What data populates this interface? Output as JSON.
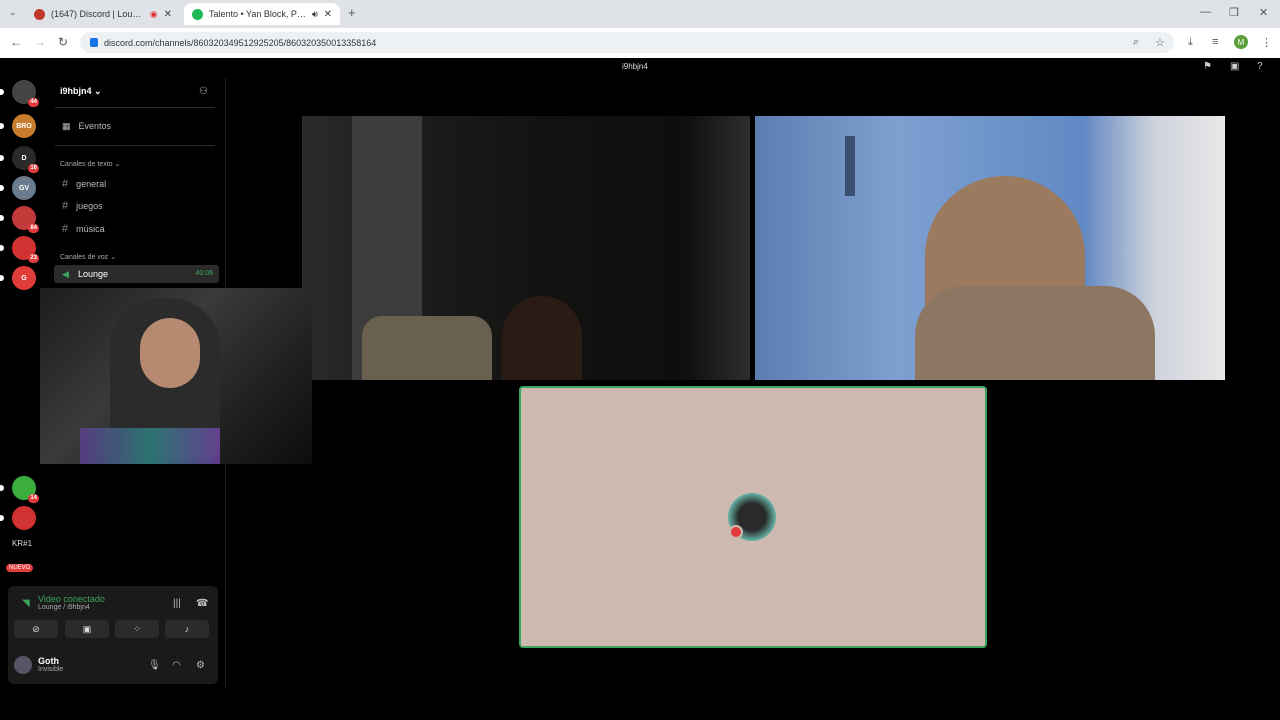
{
  "browser": {
    "tabs": [
      {
        "title": "(1647) Discord | Lounge | i9",
        "active": false,
        "favicon_color": "#5865f2"
      },
      {
        "title": "Talento • Yan Block, Panda (",
        "active": true,
        "favicon_color": "#1db954"
      }
    ],
    "url": "discord.com/channels/860320349512925205/860320350013358164",
    "profile_initial": "M"
  },
  "discord": {
    "header_title": "i9hbjn4",
    "guild_name": "i9hbjn4",
    "events_label": "Eventos",
    "text_category": "Canales de texto",
    "text_channels": [
      "general",
      "juegos",
      "música"
    ],
    "voice_category": "Canales de voz",
    "voice_channel": {
      "name": "Lounge",
      "time": "40:06"
    },
    "servers": [
      {
        "label": "",
        "badge": "44",
        "color": "#444"
      },
      {
        "label": "BRO",
        "badge": "",
        "color": "#c77d2b"
      },
      {
        "label": "D",
        "badge": "16",
        "color": "#2a2a2a"
      },
      {
        "label": "GV",
        "badge": "",
        "color": "#6b7c8c"
      },
      {
        "label": "",
        "badge": "84",
        "color": "#c23a3a"
      },
      {
        "label": "",
        "badge": "23",
        "color": "#d23232"
      },
      {
        "label": "G",
        "badge": "",
        "color": "#e03c3c"
      },
      {
        "label": "",
        "badge": "14",
        "color": "#3cae3c"
      },
      {
        "label": "",
        "badge": "",
        "color": "#d23232"
      }
    ],
    "kr_label": "KR#1",
    "new_label": "NUEVO",
    "voice_status": {
      "title": "Video conectado",
      "sub": "Lounge / i9hbjn4"
    },
    "user": {
      "name": "Goth",
      "status": "Invisible"
    }
  }
}
